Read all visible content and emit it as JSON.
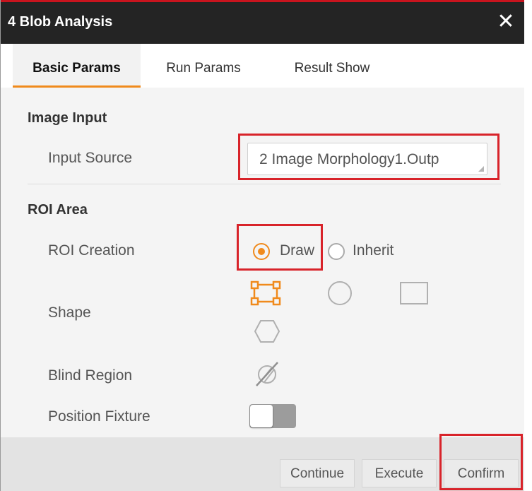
{
  "window": {
    "title": "4 Blob Analysis",
    "close_glyph": "✕"
  },
  "tabs": [
    {
      "label": "Basic Params",
      "active": true
    },
    {
      "label": "Run Params",
      "active": false
    },
    {
      "label": "Result Show",
      "active": false
    }
  ],
  "image_input": {
    "section_title": "Image Input",
    "input_source": {
      "label": "Input Source",
      "value": "2 Image Morphology1.Outp"
    }
  },
  "roi_area": {
    "section_title": "ROI Area",
    "roi_creation": {
      "label": "ROI Creation",
      "options": [
        {
          "label": "Draw",
          "selected": true
        },
        {
          "label": "Inherit",
          "selected": false
        }
      ]
    },
    "shape": {
      "label": "Shape",
      "options": [
        "rectangle-roi-icon",
        "circle-icon",
        "rectangle-icon",
        "polygon-icon"
      ],
      "selected": "rectangle-roi-icon"
    },
    "blind_region": {
      "label": "Blind Region",
      "icon": "blind-region-icon"
    },
    "position_fixture": {
      "label": "Position Fixture",
      "enabled": false
    }
  },
  "footer": {
    "continue_label": "Continue",
    "execute_label": "Execute",
    "confirm_label": "Confirm"
  },
  "colors": {
    "accent": "#f08a1c",
    "highlight": "#d8232a",
    "titlebar": "#242424"
  }
}
